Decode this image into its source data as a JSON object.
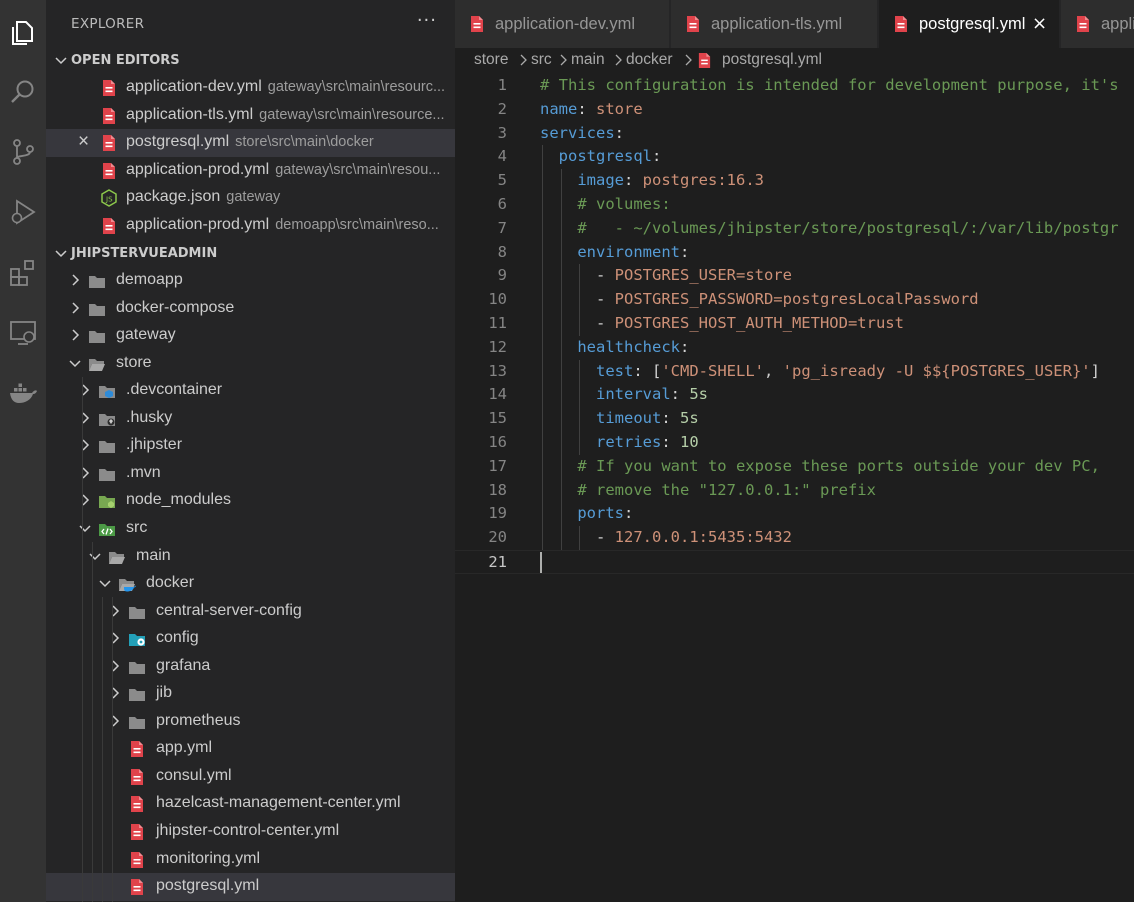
{
  "activity_bar": {
    "items": [
      {
        "icon": "files-icon"
      },
      {
        "icon": "search-icon"
      },
      {
        "icon": "source-control-icon"
      },
      {
        "icon": "run-debug-icon"
      },
      {
        "icon": "extensions-icon"
      },
      {
        "icon": "remote-explorer-icon"
      },
      {
        "icon": "docker-icon"
      }
    ]
  },
  "sidebar": {
    "title": "EXPLORER",
    "more": "···",
    "open_editors": {
      "title": "OPEN EDITORS",
      "items": [
        {
          "name": "application-dev.yml",
          "path": "gateway\\src\\main\\resourc...",
          "icon": "yaml-file-icon"
        },
        {
          "name": "application-tls.yml",
          "path": "gateway\\src\\main\\resource...",
          "icon": "yaml-file-icon"
        },
        {
          "name": "postgresql.yml",
          "path": "store\\src\\main\\docker",
          "icon": "yaml-file-icon",
          "close": "×"
        },
        {
          "name": "application-prod.yml",
          "path": "gateway\\src\\main\\resou...",
          "icon": "yaml-file-icon"
        },
        {
          "name": "package.json",
          "path": "gateway",
          "icon": "nodejs-file-icon"
        },
        {
          "name": "application-prod.yml",
          "path": "demoapp\\src\\main\\reso...",
          "icon": "yaml-file-icon"
        }
      ]
    },
    "workspace": {
      "title": "JHIPSTERVUEADMIN",
      "tree": [
        {
          "label": "demoapp",
          "kind": "folder"
        },
        {
          "label": "docker-compose",
          "kind": "folder"
        },
        {
          "label": "gateway",
          "kind": "folder"
        },
        {
          "label": "store",
          "kind": "folder-open"
        },
        {
          "label": ".devcontainer",
          "kind": "devcontainer-folder"
        },
        {
          "label": ".husky",
          "kind": "husky-folder"
        },
        {
          "label": ".jhipster",
          "kind": "folder"
        },
        {
          "label": ".mvn",
          "kind": "folder"
        },
        {
          "label": "node_modules",
          "kind": "node-folder"
        },
        {
          "label": "src",
          "kind": "src-folder"
        },
        {
          "label": "main",
          "kind": "folder-open"
        },
        {
          "label": "docker",
          "kind": "docker-folder"
        },
        {
          "label": "central-server-config",
          "kind": "folder"
        },
        {
          "label": "config",
          "kind": "config-folder"
        },
        {
          "label": "grafana",
          "kind": "folder"
        },
        {
          "label": "jib",
          "kind": "folder"
        },
        {
          "label": "prometheus",
          "kind": "folder"
        },
        {
          "label": "app.yml",
          "kind": "yaml"
        },
        {
          "label": "consul.yml",
          "kind": "yaml"
        },
        {
          "label": "hazelcast-management-center.yml",
          "kind": "yaml"
        },
        {
          "label": "jhipster-control-center.yml",
          "kind": "yaml"
        },
        {
          "label": "monitoring.yml",
          "kind": "yaml"
        },
        {
          "label": "postgresql.yml",
          "kind": "yaml",
          "selected": true
        }
      ]
    }
  },
  "editor": {
    "tabs": [
      {
        "label": "application-dev.yml",
        "active": false
      },
      {
        "label": "application-tls.yml",
        "active": false
      },
      {
        "label": "postgresql.yml",
        "active": true,
        "close": "×"
      },
      {
        "label": "appli",
        "active": false
      }
    ],
    "breadcrumb": [
      "store",
      "src",
      "main",
      "docker",
      "postgresql.yml"
    ],
    "current_line": 21,
    "lines": [
      {
        "n": "1",
        "t": "# This configuration is intended for development purpose, it's"
      },
      {
        "n": "2",
        "t": "name: store"
      },
      {
        "n": "3",
        "t": "services:"
      },
      {
        "n": "4",
        "t": "  postgresql:"
      },
      {
        "n": "5",
        "t": "    image: postgres:16.3"
      },
      {
        "n": "6",
        "t": "    # volumes:"
      },
      {
        "n": "7",
        "t": "    #   - ~/volumes/jhipster/store/postgresql/:/var/lib/postgr"
      },
      {
        "n": "8",
        "t": "    environment:"
      },
      {
        "n": "9",
        "t": "      - POSTGRES_USER=store"
      },
      {
        "n": "10",
        "t": "      - POSTGRES_PASSWORD=postgresLocalPassword"
      },
      {
        "n": "11",
        "t": "      - POSTGRES_HOST_AUTH_METHOD=trust"
      },
      {
        "n": "12",
        "t": "    healthcheck:"
      },
      {
        "n": "13",
        "t": "      test: ['CMD-SHELL', 'pg_isready -U $${POSTGRES_USER}']"
      },
      {
        "n": "14",
        "t": "      interval: 5s"
      },
      {
        "n": "15",
        "t": "      timeout: 5s"
      },
      {
        "n": "16",
        "t": "      retries: 10"
      },
      {
        "n": "17",
        "t": "    # If you want to expose these ports outside your dev PC,"
      },
      {
        "n": "18",
        "t": "    # remove the \"127.0.0.1:\" prefix"
      },
      {
        "n": "19",
        "t": "    ports:"
      },
      {
        "n": "20",
        "t": "      - 127.0.0.1:5435:5432"
      },
      {
        "n": "21",
        "t": ""
      }
    ]
  },
  "colors": {
    "accent": "#e51400",
    "comment": "#6a9955",
    "key": "#569cd6",
    "string": "#ce9178",
    "number": "#b5cea8"
  }
}
